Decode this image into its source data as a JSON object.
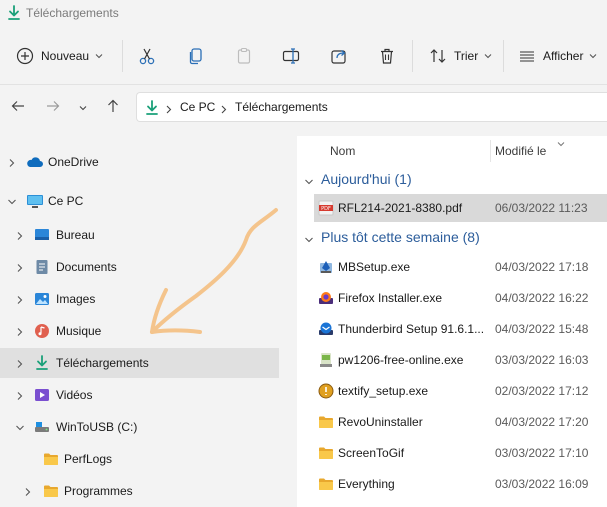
{
  "window": {
    "title": "Téléchargements",
    "title_icon": "download-icon"
  },
  "toolbar": {
    "new_label": "Nouveau",
    "sort_label": "Trier",
    "view_label": "Afficher"
  },
  "address": {
    "segments": [
      "Ce PC",
      "Téléchargements"
    ]
  },
  "nav": {
    "items": [
      {
        "label": "OneDrive",
        "icon": "onedrive-cloud-icon"
      },
      {
        "label": "Ce PC",
        "icon": "this-pc-icon"
      },
      {
        "label": "Bureau",
        "icon": "desktop-folder-icon"
      },
      {
        "label": "Documents",
        "icon": "documents-icon"
      },
      {
        "label": "Images",
        "icon": "pictures-icon"
      },
      {
        "label": "Musique",
        "icon": "music-icon"
      },
      {
        "label": "Téléchargements",
        "icon": "download-icon"
      },
      {
        "label": "Vidéos",
        "icon": "videos-icon"
      },
      {
        "label": "WinToUSB (C:)",
        "icon": "drive-icon"
      },
      {
        "label": "PerfLogs",
        "icon": "folder-icon"
      },
      {
        "label": "Programmes",
        "icon": "folder-icon"
      }
    ]
  },
  "list": {
    "col_name": "Nom",
    "col_modified": "Modifié le",
    "groups": [
      {
        "label": "Aujourd'hui (1)",
        "files": [
          {
            "name": "RFL214-2021-8380.pdf",
            "date": "06/03/2022 11:23",
            "icon": "pdf-icon"
          }
        ]
      },
      {
        "label": "Plus tôt cette semaine (8)",
        "files": [
          {
            "name": "MBSetup.exe",
            "date": "04/03/2022 17:18",
            "icon": "malwarebytes-installer-icon"
          },
          {
            "name": "Firefox Installer.exe",
            "date": "04/03/2022 16:22",
            "icon": "firefox-installer-icon"
          },
          {
            "name": "Thunderbird Setup 91.6.1...",
            "date": "04/03/2022 15:48",
            "icon": "thunderbird-installer-icon"
          },
          {
            "name": "pw1206-free-online.exe",
            "date": "03/03/2022 16:03",
            "icon": "installer-icon"
          },
          {
            "name": "textify_setup.exe",
            "date": "02/03/2022 17:12",
            "icon": "textify-installer-icon"
          },
          {
            "name": "RevoUninstaller",
            "date": "04/03/2022 17:20",
            "icon": "folder-icon"
          },
          {
            "name": "ScreenToGif",
            "date": "03/03/2022 17:10",
            "icon": "folder-icon"
          },
          {
            "name": "Everything",
            "date": "03/03/2022 16:09",
            "icon": "folder-icon"
          }
        ]
      }
    ]
  },
  "colors": {
    "accent": "#1aa079",
    "group_header": "#2c5d9b",
    "annotation_arrow": "#f4c48c",
    "selection": "#d9d9d9"
  }
}
